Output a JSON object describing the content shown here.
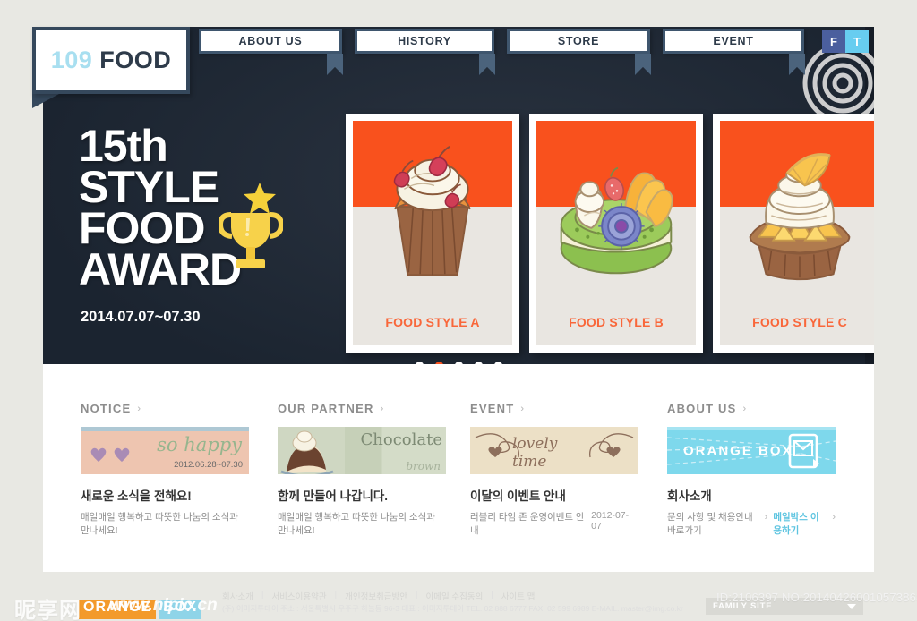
{
  "site": {
    "logo_number": "109",
    "logo_word": "FOOD"
  },
  "nav": {
    "items": [
      {
        "label": "ABOUT US"
      },
      {
        "label": "HISTORY"
      },
      {
        "label": "STORE"
      },
      {
        "label": "EVENT"
      }
    ],
    "social": [
      {
        "label": "F",
        "name": "facebook",
        "color": "#4b5f9e"
      },
      {
        "label": "T",
        "name": "twitter",
        "color": "#67cdf0"
      }
    ]
  },
  "hero": {
    "line1": "15th",
    "line2": "STYLE",
    "line3": "FOOD",
    "line4": "AWARD",
    "date": "2014.07.07~07.30",
    "cards": [
      {
        "label": "FOOD STYLE A",
        "art": "cupcake-cherry"
      },
      {
        "label": "FOOD STYLE B",
        "art": "green-macaron-fruit"
      },
      {
        "label": "FOOD STYLE C",
        "art": "orange-tart"
      }
    ],
    "dots": [
      {
        "active": false
      },
      {
        "active": true
      },
      {
        "active": false
      },
      {
        "active": false
      },
      {
        "active": false
      }
    ],
    "accent_color": "#f9511d",
    "panel_color": "#1e2733"
  },
  "sections": [
    {
      "heading": "NOTICE",
      "thumb_text": "so happy",
      "thumb_date": "2012.06.28~07.30",
      "title": "새로운 소식을 전해요!",
      "desc": "매일매일 행복하고 따뜻한 나눔의 소식과 만나세요!",
      "date": ""
    },
    {
      "heading": "OUR PARTNER",
      "thumb_text": "Chocolate",
      "thumb_sub": "brown",
      "title": "함께 만들어 나갑니다.",
      "desc": "매일매일 행복하고 따뜻한 나눔의 소식과 만나세요!",
      "date": ""
    },
    {
      "heading": "EVENT",
      "thumb_text": "lovely time",
      "title": "이달의 이벤트 안내",
      "desc": "러블리 타임 존 운영이벤트 안내",
      "date": "2012-07-07"
    },
    {
      "heading": "ABOUT US",
      "thumb_text": "ORANGE  BOX",
      "title": "회사소개",
      "link1": "문의 사항 및 채용안내 바로가기",
      "link2": "메일박스 이용하기",
      "date": ""
    }
  ],
  "footer": {
    "links": [
      "회사소개",
      "서비스이용약관",
      "개인정보취급방안",
      "이메일 수집동의",
      "사이트 맵"
    ],
    "address": "(주) 이미지투데이    주소 : 서울특별시 우주구 하늘동 96-3   대표 : 이미지투데이  TEL. 02 888 6777  FAX. 02 599 6989 E-MAIL. master@img.co.kr",
    "family_site": "FAMILY SITE"
  },
  "watermark": {
    "id_text": "ID:2106397 NO:20140426001057386323",
    "logo_orange": "ORANGE",
    "logo_blue": "BOX",
    "cn_text": "昵享网",
    "url": "www.nipic.cn"
  }
}
